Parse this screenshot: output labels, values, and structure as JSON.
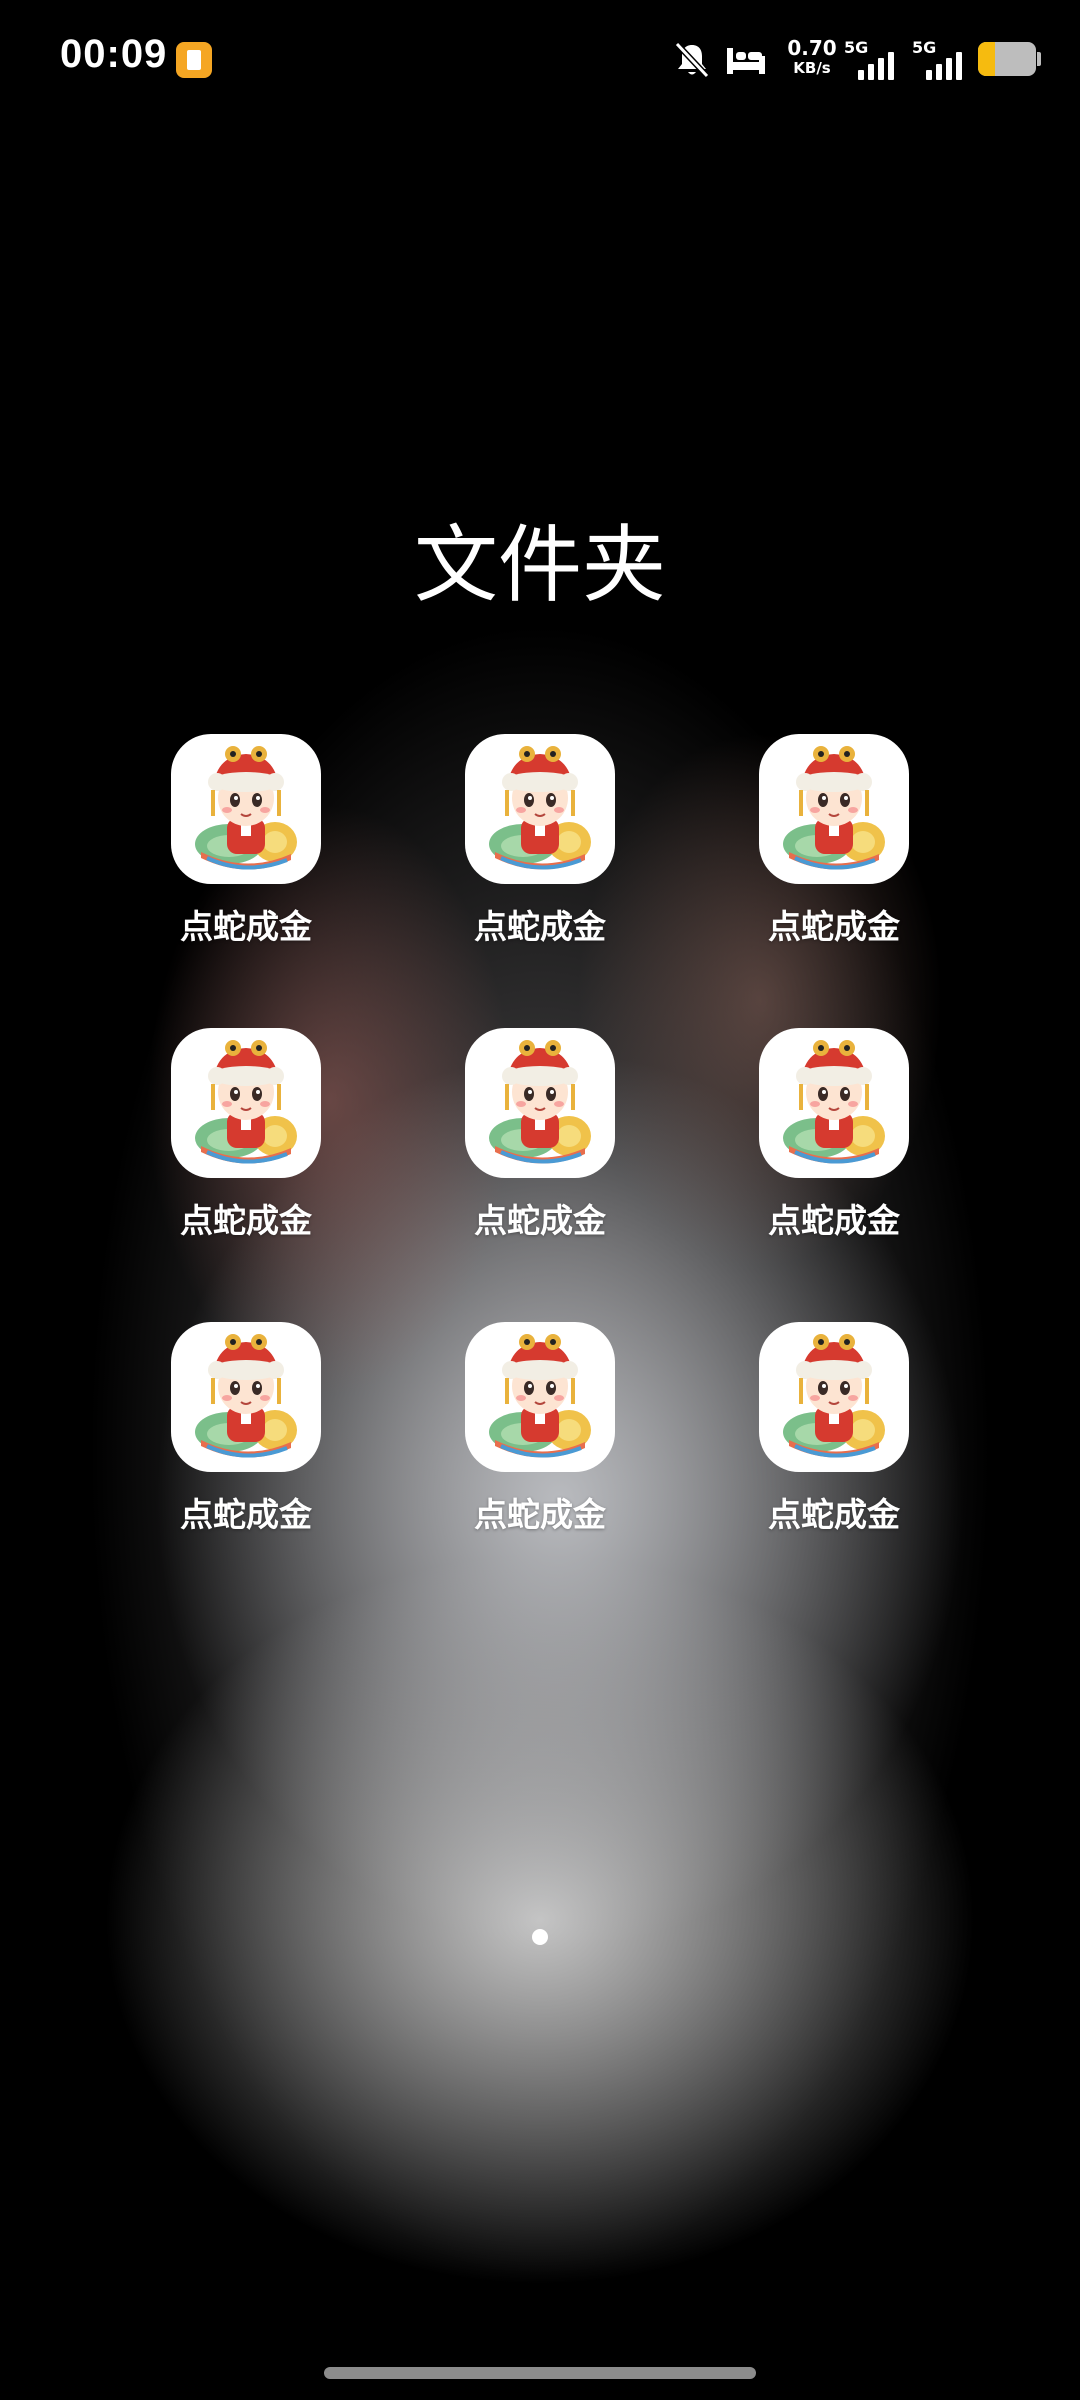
{
  "status_bar": {
    "time": "00:09",
    "net_speed_value": "0.70",
    "net_speed_unit": "KB/s",
    "sim1_label": "5G",
    "sim2_label": "5G",
    "battery_level": 0.3,
    "colors": {
      "notification_app": "#f5a623",
      "battery_fill": "#f6bb0f"
    },
    "icons": [
      "notification-app-icon",
      "mute-icon",
      "sleep-mode-icon",
      "signal-icon",
      "battery-icon"
    ]
  },
  "folder": {
    "title": "文件夹",
    "apps": [
      {
        "label": "点蛇成金",
        "icon": "snake-mascot-icon"
      },
      {
        "label": "点蛇成金",
        "icon": "snake-mascot-icon"
      },
      {
        "label": "点蛇成金",
        "icon": "snake-mascot-icon"
      },
      {
        "label": "点蛇成金",
        "icon": "snake-mascot-icon"
      },
      {
        "label": "点蛇成金",
        "icon": "snake-mascot-icon"
      },
      {
        "label": "点蛇成金",
        "icon": "snake-mascot-icon"
      },
      {
        "label": "点蛇成金",
        "icon": "snake-mascot-icon"
      },
      {
        "label": "点蛇成金",
        "icon": "snake-mascot-icon"
      },
      {
        "label": "点蛇成金",
        "icon": "snake-mascot-icon"
      }
    ]
  },
  "pagination": {
    "current_page": 1,
    "total_pages": 1
  }
}
